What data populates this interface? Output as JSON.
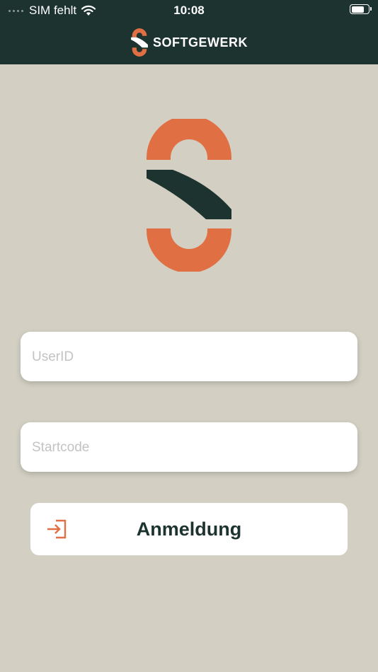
{
  "status_bar": {
    "carrier": "SIM fehlt",
    "time": "10:08",
    "battery_level": 0.75
  },
  "header": {
    "brand": "SOFTGEWERK"
  },
  "login_form": {
    "userid_placeholder": "UserID",
    "startcode_placeholder": "Startcode",
    "submit_label": "Anmeldung"
  },
  "colors": {
    "header_bg": "#1d3330",
    "page_bg": "#d3d0c3",
    "accent_orange": "#e07044",
    "dark_green": "#1d3330"
  },
  "icons": {
    "wifi": "wifi-icon",
    "battery": "battery-icon",
    "login": "login-arrow-icon",
    "logo": "softgewerk-s-logo"
  }
}
